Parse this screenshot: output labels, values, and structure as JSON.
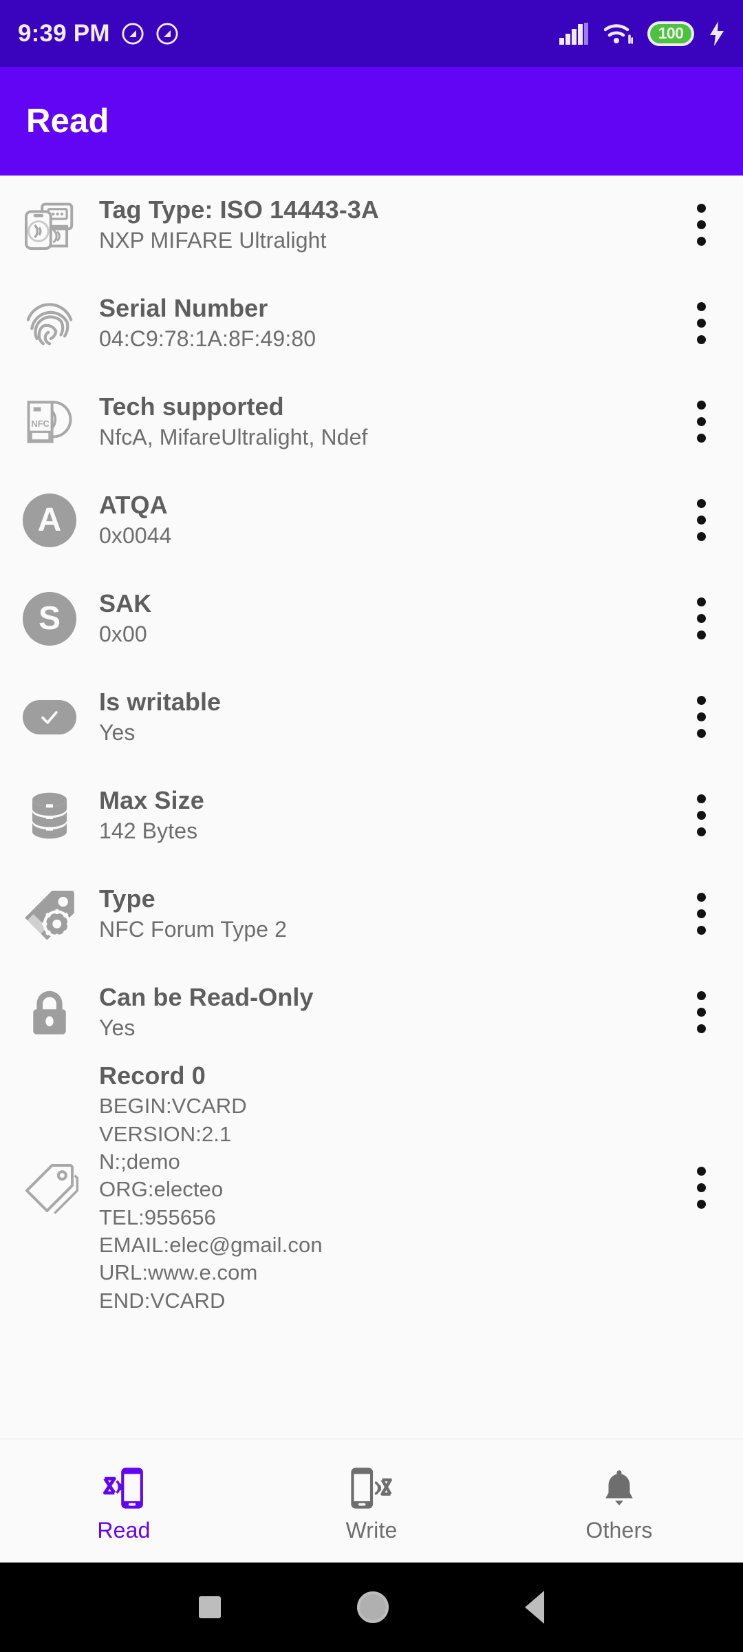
{
  "status_bar": {
    "time": "9:39 PM",
    "icons_left": [
      "dnd-icon",
      "dnd-icon"
    ],
    "icons_right": [
      "signal-icon",
      "wifi-icon",
      "battery-icon",
      "charging-bolt-icon"
    ],
    "battery_level": "100",
    "battery_color": "#4CC23F",
    "background": "#3A04BF"
  },
  "app_bar": {
    "title": "Read",
    "background": "#6205F5",
    "text_color": "#FFFFFF"
  },
  "list": {
    "menu_icon": "kebab-menu-icon",
    "items": [
      {
        "icon": "nfc-payment-icon",
        "title": "Tag Type: ISO 14443-3A",
        "subtitle": "NXP MIFARE Ultralight"
      },
      {
        "icon": "fingerprint-icon",
        "title": "Serial Number",
        "subtitle": "04:C9:78:1A:8F:49:80"
      },
      {
        "icon": "nfc-card-icon",
        "title": "Tech supported",
        "subtitle": "NfcA, MifareUltralight, Ndef"
      },
      {
        "icon": "letter-a-avatar",
        "avatar_letter": "A",
        "title": "ATQA",
        "subtitle": "0x0044"
      },
      {
        "icon": "letter-s-avatar",
        "avatar_letter": "S",
        "title": "SAK",
        "subtitle": "0x00"
      },
      {
        "icon": "checkmark-icon",
        "title": "Is writable",
        "subtitle": "Yes"
      },
      {
        "icon": "database-icon",
        "title": "Max Size",
        "subtitle": "142 Bytes"
      },
      {
        "icon": "tag-gear-icon",
        "title": "Type",
        "subtitle": "NFC Forum Type 2"
      },
      {
        "icon": "lock-icon",
        "title": "Can be Read-Only",
        "subtitle": "Yes"
      },
      {
        "icon": "tag-icon",
        "title": "Record 0",
        "subtitle": "BEGIN:VCARD\nVERSION:2.1\nN:;demo\nORG:electeo\nTEL:955656\nEMAIL:elec@gmail.con\nURL:www.e.com\nEND:VCARD"
      }
    ]
  },
  "bottom_nav": {
    "active_color": "#6205F5",
    "inactive_color": "#6E6E6E",
    "items": [
      {
        "label": "Read",
        "icon": "nfc-read-phone-icon",
        "active": true
      },
      {
        "label": "Write",
        "icon": "nfc-write-phone-icon",
        "active": false
      },
      {
        "label": "Others",
        "icon": "bell-icon",
        "active": false
      }
    ]
  },
  "android_nav": {
    "buttons": [
      "recents-square-icon",
      "home-circle-icon",
      "back-triangle-icon"
    ]
  }
}
